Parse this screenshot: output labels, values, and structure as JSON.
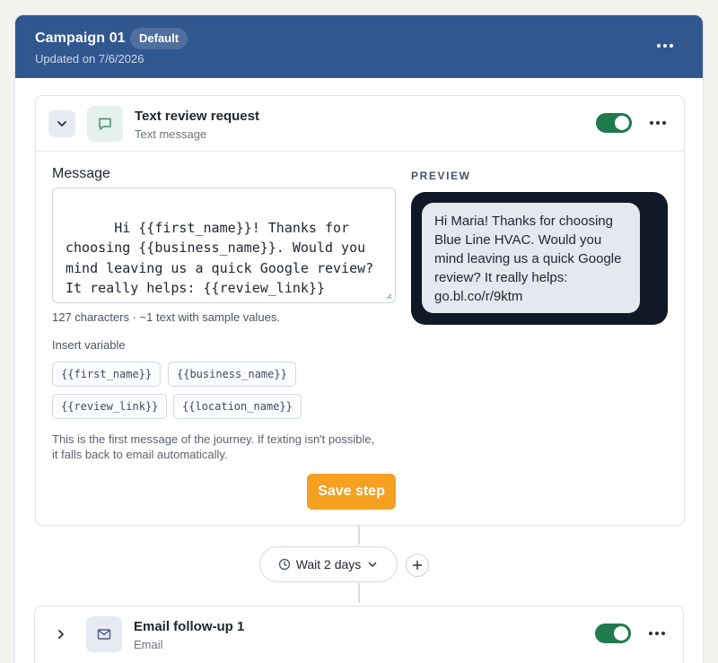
{
  "campaign": {
    "title": "Campaign 01",
    "badge": "Default",
    "updated": "Updated on 7/6/2026"
  },
  "step1": {
    "title": "Text review request",
    "type": "Text message",
    "enabled": true,
    "message_label": "Message",
    "message": "Hi {{first_name}}! Thanks for choosing {{business_name}}. Would you mind leaving us a quick Google review? It really helps: {{review_link}}",
    "char_count": "127 characters · ~1 text with sample values.",
    "insert_label": "Insert variable",
    "variables": [
      "{{first_name}}",
      "{{business_name}}",
      "{{review_link}}",
      "{{location_name}}"
    ],
    "note": "This is the first message of the journey. If texting isn't possible, it falls back to email automatically.",
    "save_label": "Save step",
    "preview_label": "PREVIEW",
    "preview_text": "Hi Maria! Thanks for choosing Blue Line HVAC. Would you mind leaving us a quick Google review? It really helps: go.bl.co/r/9ktm"
  },
  "wait": {
    "label": "Wait 2 days"
  },
  "step2": {
    "title": "Email follow-up 1",
    "type": "Email",
    "enabled": true
  },
  "colors": {
    "header_bg": "#305790",
    "toggle_on": "#1f7a4d",
    "save_button": "#f5a020",
    "phone_bg": "#111827"
  },
  "icons": [
    "more-icon",
    "chevron-down-icon",
    "chevron-right-icon",
    "message-icon",
    "mail-icon",
    "clock-icon",
    "plus-icon"
  ]
}
